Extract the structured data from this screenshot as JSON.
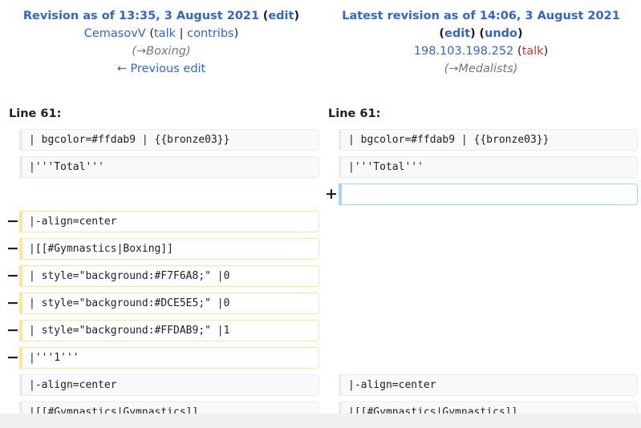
{
  "left_header": {
    "revision_title": "Revision as of 13:35, 3 August 2021",
    "edit_label": "edit",
    "user": "CemasovV",
    "talk_label": "talk",
    "contribs_label": "contribs",
    "summary_arrow": "→",
    "summary_section": "Boxing",
    "previous_edit": "← Previous edit"
  },
  "right_header": {
    "revision_title": "Latest revision as of 14:06, 3 August 2021",
    "edit_label": "edit",
    "undo_label": "undo",
    "user": "198.103.198.252",
    "talk_label": "talk",
    "summary_arrow": "→",
    "summary_section": "Medalists"
  },
  "left_line_number": "Line 61:",
  "right_line_number": "Line 61:",
  "markers": {
    "minus": "−",
    "plus": "+"
  },
  "left_lines": [
    "| bgcolor=#ffdab9 | {{bronze03}}",
    "|'''Total'''",
    "|-align=center",
    "|[[#Gymnastics|Boxing]]",
    "| style=\"background:#F7F6A8;\" |0",
    "| style=\"background:#DCE5E5;\" |0",
    "| style=\"background:#FFDAB9;\" |1",
    "|'''1'''",
    "|-align=center",
    "|[[#Gymnastics|Gymnastics]]"
  ],
  "right_lines": [
    "| bgcolor=#ffdab9 | {{bronze03}}",
    "|'''Total'''",
    "",
    "|-align=center",
    "|[[#Gymnastics|Gymnastics]]"
  ],
  "colors": {
    "link": "#3366cc",
    "redlink": "#d73333",
    "deleted_border": "#ffe49c",
    "added_border": "#a3d3ff",
    "context_bg": "#f8f9fa"
  }
}
